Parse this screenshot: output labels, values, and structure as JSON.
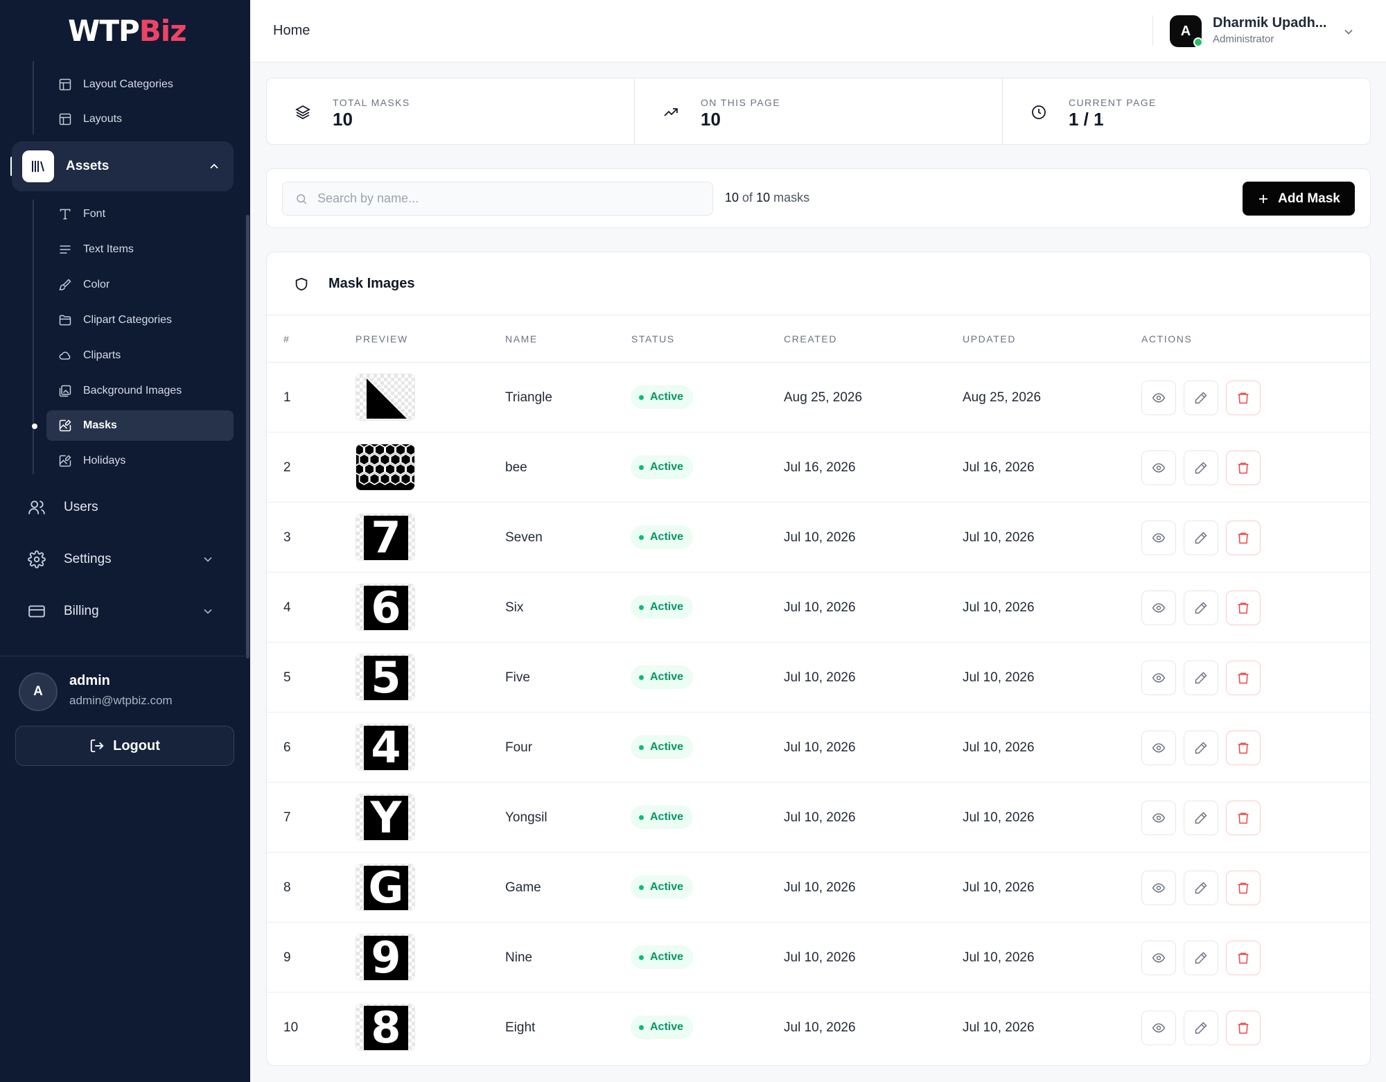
{
  "brand": {
    "logo_left": "WTP",
    "logo_right": "Biz"
  },
  "sidebar": {
    "top_items": [
      {
        "label": "Layout Categories",
        "icon": "layout-icon"
      },
      {
        "label": "Layouts",
        "icon": "layout-icon"
      }
    ],
    "assets_label": "Assets",
    "asset_items": [
      {
        "label": "Font",
        "icon": "type-icon"
      },
      {
        "label": "Text Items",
        "icon": "text-lines-icon"
      },
      {
        "label": "Color",
        "icon": "paint-brush-icon"
      },
      {
        "label": "Clipart Categories",
        "icon": "folder-icon"
      },
      {
        "label": "Cliparts",
        "icon": "cloud-icon"
      },
      {
        "label": "Background Images",
        "icon": "images-icon"
      },
      {
        "label": "Masks",
        "icon": "image-edit-icon",
        "active": true
      },
      {
        "label": "Holidays",
        "icon": "image-edit-icon"
      }
    ],
    "users_label": "Users",
    "settings_label": "Settings",
    "billing_label": "Billing",
    "user": {
      "initial": "A",
      "name": "admin",
      "email": "admin@wtpbiz.com"
    },
    "logout_label": "Logout"
  },
  "topbar": {
    "breadcrumb": "Home",
    "user_initial": "A",
    "user_name": "Dharmik Upadh...",
    "user_role": "Administrator"
  },
  "stats": [
    {
      "label": "TOTAL MASKS",
      "value": "10",
      "icon": "layers-icon"
    },
    {
      "label": "ON THIS PAGE",
      "value": "10",
      "icon": "trending-up-icon"
    },
    {
      "label": "CURRENT PAGE",
      "value": "1 / 1",
      "icon": "clock-icon"
    }
  ],
  "toolbar": {
    "search_placeholder": "Search by name...",
    "search_value": "",
    "count_shown": "10",
    "count_of": "of",
    "count_total": "10",
    "count_unit": "masks",
    "add_label": "Add Mask"
  },
  "table": {
    "title": "Mask Images",
    "columns": [
      "#",
      "PREVIEW",
      "NAME",
      "STATUS",
      "CREATED",
      "UPDATED",
      "ACTIONS"
    ],
    "rows": [
      {
        "num": "1",
        "name": "Triangle",
        "status": "Active",
        "created": "Aug 25, 2026",
        "updated": "Aug 25, 2026",
        "preview": "triangle"
      },
      {
        "num": "2",
        "name": "bee",
        "status": "Active",
        "created": "Jul 16, 2026",
        "updated": "Jul 16, 2026",
        "preview": "hexagons"
      },
      {
        "num": "3",
        "name": "Seven",
        "status": "Active",
        "created": "Jul 10, 2026",
        "updated": "Jul 10, 2026",
        "preview": "7"
      },
      {
        "num": "4",
        "name": "Six",
        "status": "Active",
        "created": "Jul 10, 2026",
        "updated": "Jul 10, 2026",
        "preview": "6"
      },
      {
        "num": "5",
        "name": "Five",
        "status": "Active",
        "created": "Jul 10, 2026",
        "updated": "Jul 10, 2026",
        "preview": "5"
      },
      {
        "num": "6",
        "name": "Four",
        "status": "Active",
        "created": "Jul 10, 2026",
        "updated": "Jul 10, 2026",
        "preview": "4"
      },
      {
        "num": "7",
        "name": "Yongsil",
        "status": "Active",
        "created": "Jul 10, 2026",
        "updated": "Jul 10, 2026",
        "preview": "Y"
      },
      {
        "num": "8",
        "name": "Game",
        "status": "Active",
        "created": "Jul 10, 2026",
        "updated": "Jul 10, 2026",
        "preview": "G"
      },
      {
        "num": "9",
        "name": "Nine",
        "status": "Active",
        "created": "Jul 10, 2026",
        "updated": "Jul 10, 2026",
        "preview": "9"
      },
      {
        "num": "10",
        "name": "Eight",
        "status": "Active",
        "created": "Jul 10, 2026",
        "updated": "Jul 10, 2026",
        "preview": "8"
      }
    ]
  },
  "colors": {
    "sidebar_bg": "#0f1b33",
    "brand_accent": "#ef4365",
    "status_active": "#059669",
    "delete": "#ef4444"
  }
}
